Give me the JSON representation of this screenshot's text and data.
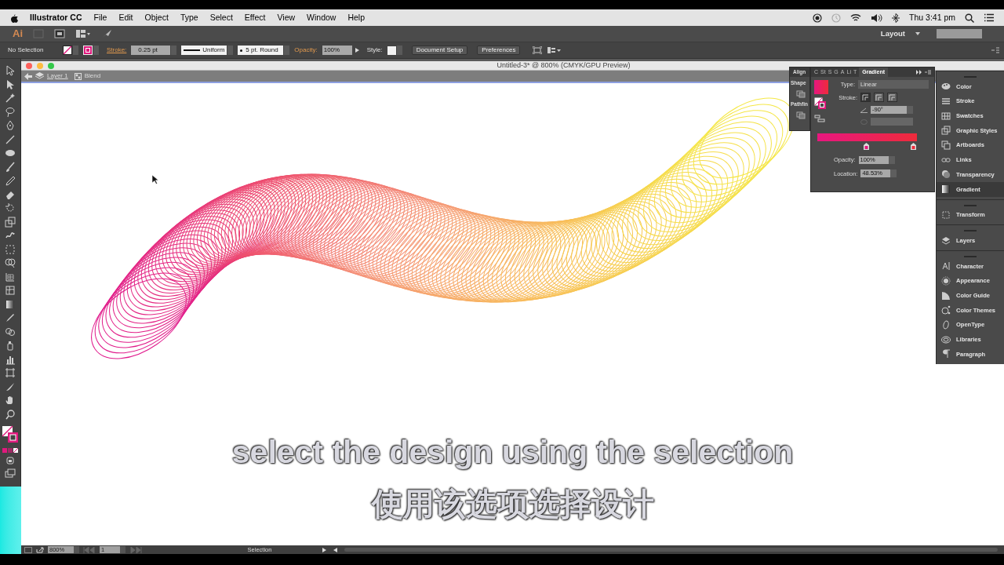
{
  "menu_bar": {
    "app_name": "Illustrator CC",
    "items": [
      "File",
      "Edit",
      "Object",
      "Type",
      "Select",
      "Effect",
      "View",
      "Window",
      "Help"
    ],
    "clock": "Thu 3:41 pm"
  },
  "app_bar": {
    "logo": "Ai",
    "layout": "Layout"
  },
  "control_bar": {
    "selection": "No Selection",
    "stroke_label": "Stroke:",
    "stroke_weight": "0.25 pt",
    "profile": "Uniform",
    "brush": "5 pt. Round",
    "opacity_label": "Opacity:",
    "opacity": "100%",
    "style_label": "Style:",
    "buttons": [
      "Document Setup",
      "Preferences"
    ]
  },
  "document": {
    "title": "Untitled-3* @ 800% (CMYK/GPU Preview)",
    "breadcrumbs": [
      "Layer 1",
      "Blend"
    ]
  },
  "align_panel": {
    "tab": "Align",
    "sections": [
      "Shape",
      "Pathfin"
    ]
  },
  "gradient_panel": {
    "tabs": [
      {
        "label": "C",
        "selected": false
      },
      {
        "label": "St",
        "selected": false
      },
      {
        "label": "S",
        "selected": false
      },
      {
        "label": "G",
        "selected": false
      },
      {
        "label": "A",
        "selected": false
      },
      {
        "label": "Li",
        "selected": false
      },
      {
        "label": "T",
        "selected": false
      },
      {
        "label": "Gradient",
        "selected": true
      }
    ],
    "type_label": "Type:",
    "type": "Linear",
    "stroke_label": "Stroke:",
    "angle": "-90°",
    "stops": [
      {
        "color": "#e8177f",
        "level": 0.49
      },
      {
        "color": "#ee2b3b",
        "level": 0.99
      }
    ],
    "opacity_label": "Opacity:",
    "opacity": "100%",
    "location_label": "Location:",
    "location": "48.53%"
  },
  "dock": {
    "groups": [
      [
        {
          "label": "Color",
          "selected": false
        },
        {
          "label": "Stroke",
          "selected": false
        },
        {
          "label": "Swatches",
          "selected": false
        },
        {
          "label": "Graphic Styles",
          "selected": false
        },
        {
          "label": "Artboards",
          "selected": false
        },
        {
          "label": "Links",
          "selected": false
        },
        {
          "label": "Transparency",
          "selected": false
        },
        {
          "label": "Gradient",
          "selected": true
        }
      ],
      [
        {
          "label": "Transform",
          "selected": false
        }
      ],
      [
        {
          "label": "Layers",
          "selected": false
        }
      ],
      [
        {
          "label": "Character",
          "selected": false
        },
        {
          "label": "Appearance",
          "selected": false
        },
        {
          "label": "Color Guide",
          "selected": false
        },
        {
          "label": "Color Themes",
          "selected": false
        },
        {
          "label": "OpenType",
          "selected": false
        },
        {
          "label": "Libraries",
          "selected": false
        },
        {
          "label": "Paragraph",
          "selected": false
        }
      ]
    ]
  },
  "status_bar": {
    "zoom": "800%",
    "artboard": "1",
    "tool": "Selection"
  },
  "subtitles": [
    "select the design using the selection",
    "使用该选项选择设计"
  ]
}
